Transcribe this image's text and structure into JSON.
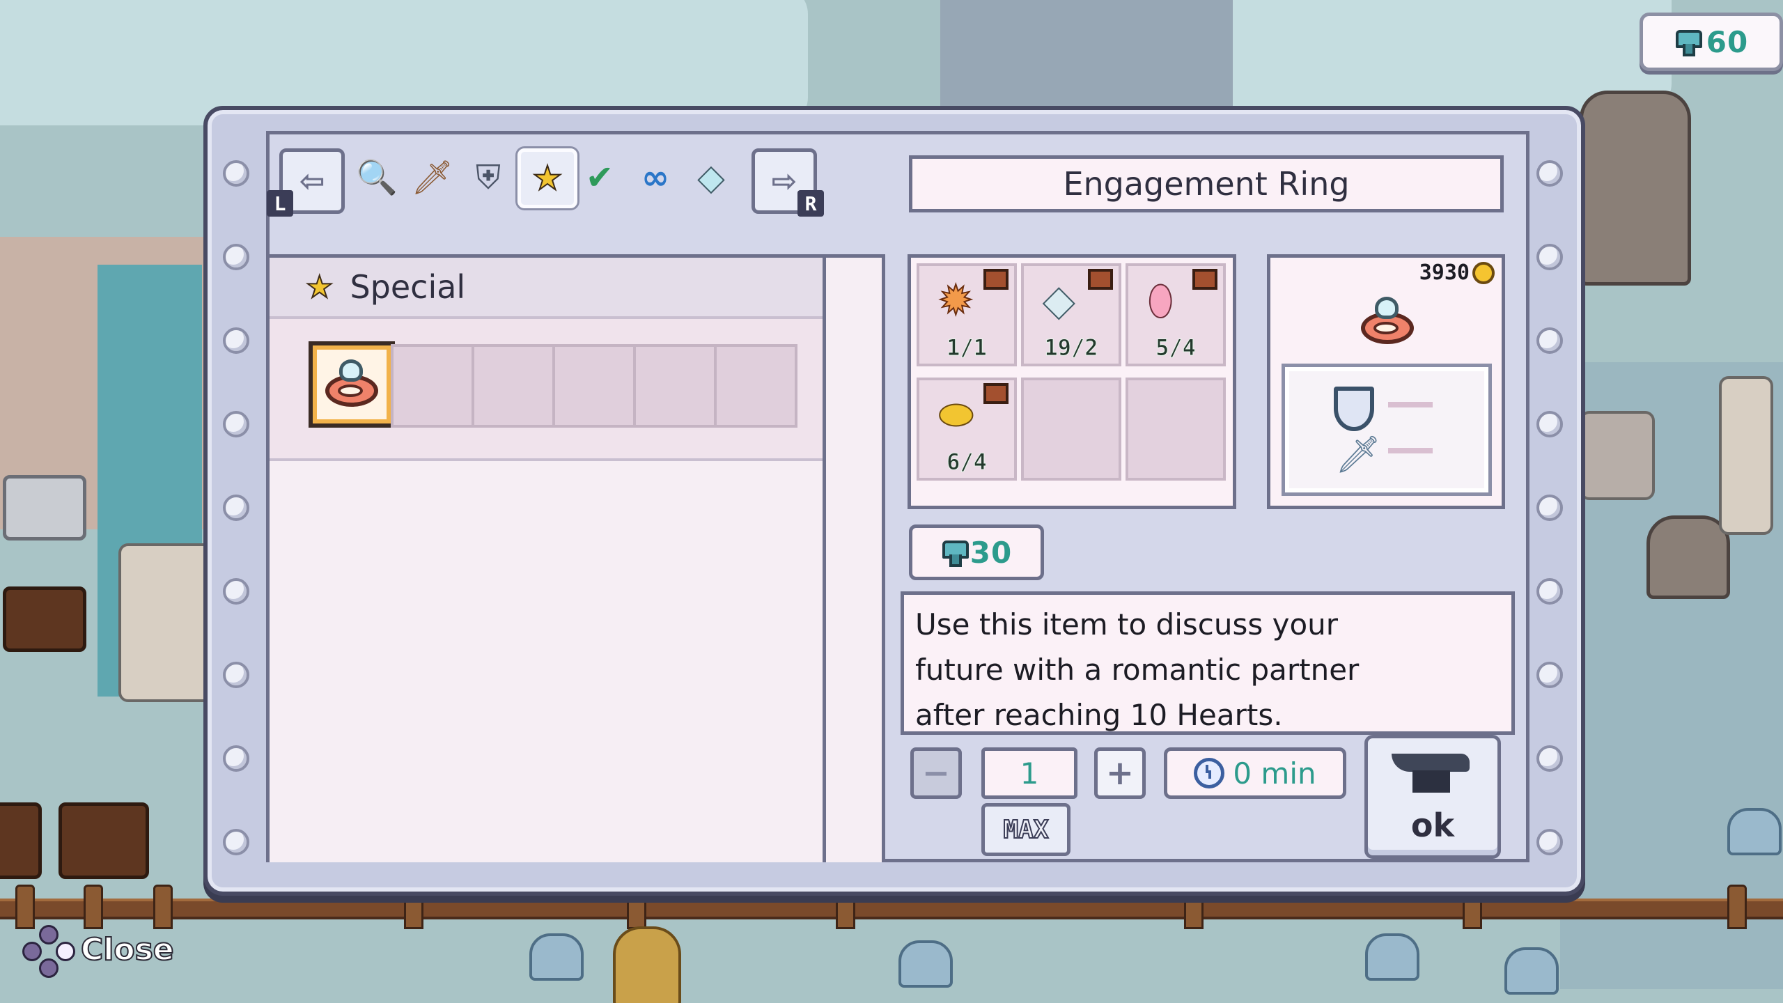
{
  "currency": {
    "amount": "60",
    "icon": "gem-icon"
  },
  "tabs": {
    "prev_key": "L",
    "next_key": "R",
    "items": [
      {
        "name": "tools",
        "icon": "magnifier-icon",
        "glyph": "🔍"
      },
      {
        "name": "weapons",
        "icon": "sword-icon",
        "glyph": "🗡"
      },
      {
        "name": "armor",
        "icon": "armor-icon",
        "glyph": "⛨"
      },
      {
        "name": "special",
        "icon": "star-icon",
        "glyph": "★",
        "active": true
      },
      {
        "name": "completed",
        "icon": "checkmark-icon",
        "glyph": "✔"
      },
      {
        "name": "infinite",
        "icon": "infinity-icon",
        "glyph": "∞"
      },
      {
        "name": "gems",
        "icon": "diamond-icon",
        "glyph": "◆"
      }
    ]
  },
  "category": {
    "label": "Special",
    "icon": "star-icon"
  },
  "item": {
    "name": "Engagement Ring",
    "price": "3930",
    "cost": "30",
    "description": "Use this item to discuss your\nfuture with a romantic partner\nafter reaching 10 Hearts."
  },
  "ingredients": [
    {
      "icon": "sun-orb-icon",
      "glyph": "✹",
      "color": "#f39a4a",
      "count": "1/1"
    },
    {
      "icon": "diamond-icon",
      "glyph": "◆",
      "color": "#dcecf2",
      "count": "19/2"
    },
    {
      "icon": "pink-crystal-icon",
      "glyph": "⬮",
      "color": "#f7a6c0",
      "count": "5/4"
    },
    {
      "icon": "gold-bar-icon",
      "glyph": "⬬",
      "color": "#f2c531",
      "count": "6/4"
    }
  ],
  "craft": {
    "quantity": "1",
    "max_label": "MAX",
    "time": "0 min",
    "ok_label": "ok"
  },
  "footer": {
    "close_label": "Close"
  }
}
